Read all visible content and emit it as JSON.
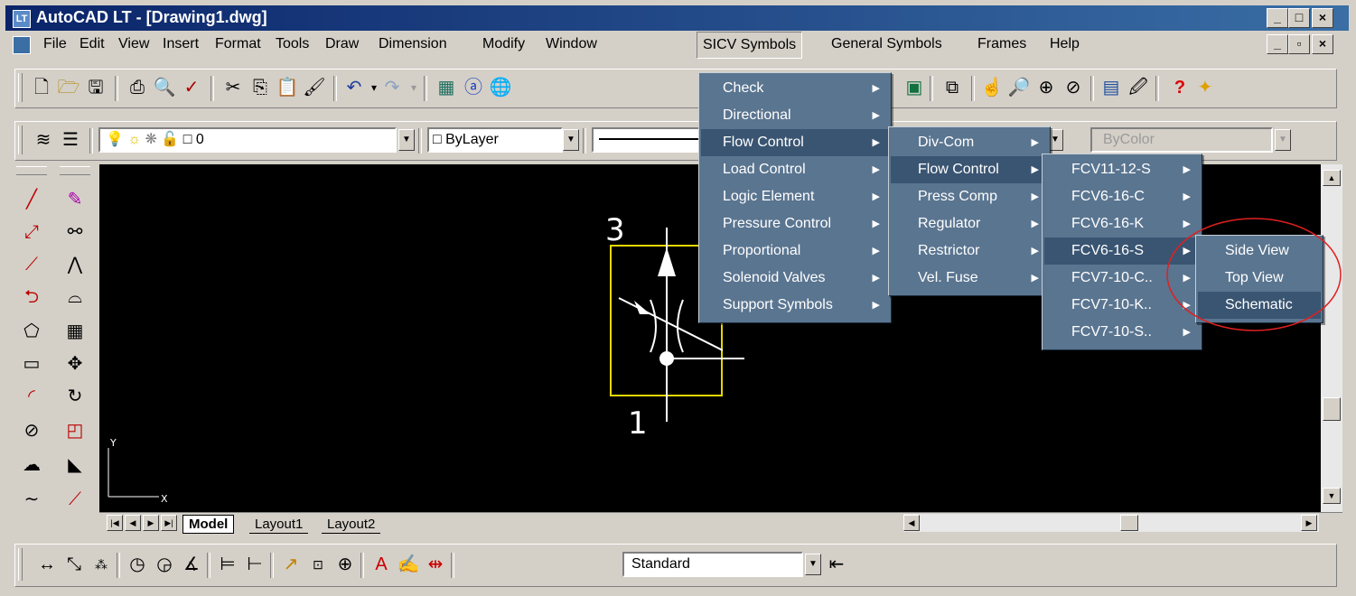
{
  "window": {
    "title": "AutoCAD LT - [Drawing1.dwg]",
    "icon_text": "LT"
  },
  "menubar": {
    "items": [
      {
        "label": "File"
      },
      {
        "label": "Edit"
      },
      {
        "label": "View"
      },
      {
        "label": "Insert"
      },
      {
        "label": "Format"
      },
      {
        "label": "Tools"
      },
      {
        "label": "Draw"
      },
      {
        "label": "Dimension"
      },
      {
        "label": "Modify"
      },
      {
        "label": "Window"
      },
      {
        "label": "SICV Symbols"
      },
      {
        "label": "General Symbols"
      },
      {
        "label": "Frames"
      },
      {
        "label": "Help"
      }
    ]
  },
  "layer_bar": {
    "layer_value": "0",
    "color_value": "ByLayer",
    "plotstyle_value": "ByColor"
  },
  "dimstyle_value": "Standard",
  "menus": {
    "sicv": [
      "Check",
      "Directional",
      "Flow Control",
      "Load Control",
      "Logic Element",
      "Pressure Control",
      "Proportional",
      "Solenoid Valves",
      "Support Symbols"
    ],
    "flow_control": [
      "Div-Com",
      "Flow Control",
      "Press Comp",
      "Regulator",
      "Restrictor",
      "Vel. Fuse"
    ],
    "flow_control_sub": [
      "FCV11-12-S",
      "FCV6-16-C",
      "FCV6-16-K",
      "FCV6-16-S",
      "FCV7-10-C..",
      "FCV7-10-K..",
      "FCV7-10-S.."
    ],
    "fcv_sub": [
      "Side View",
      "Top View",
      "Schematic"
    ]
  },
  "drawing": {
    "port_top": "3",
    "port_bottom": "1",
    "ucs_x": "X",
    "ucs_y": "Y"
  },
  "tabs": [
    "Model",
    "Layout1",
    "Layout2"
  ],
  "colors": {
    "menu_bg": "#5a7590",
    "menu_highlight": "#3a5572",
    "annotation_ellipse": "#e02020",
    "symbol_border": "#e8d800"
  }
}
